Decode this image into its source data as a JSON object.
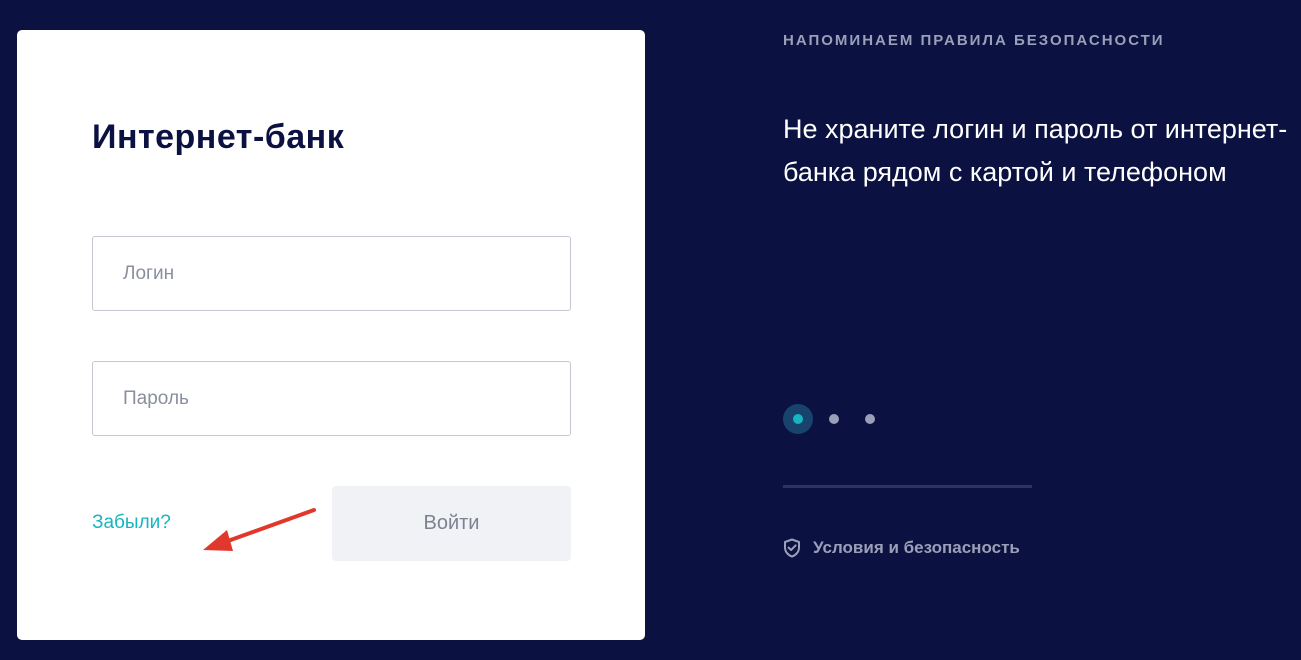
{
  "login_card": {
    "title": "Интернет-банк",
    "login_placeholder": "Логин",
    "password_placeholder": "Пароль",
    "forgot_label": "Забыли?",
    "submit_label": "Войти",
    "annotation_arrow_color": "#e0392b"
  },
  "info_panel": {
    "heading": "НАПОМИНАЕМ ПРАВИЛА БЕЗОПАСНОСТИ",
    "slide_text": "Не храните логин и пароль от интернет-банка рядом с картой и телефоном",
    "carousel": {
      "slide_count": 3,
      "active_index": 0
    },
    "terms_icon": "shield-check-icon",
    "terms_label": "Условия и безопасность"
  },
  "colors": {
    "background": "#0b1140",
    "accent": "#17b5c2",
    "muted_text": "#9aa0b8",
    "title_text": "#0b1140"
  }
}
